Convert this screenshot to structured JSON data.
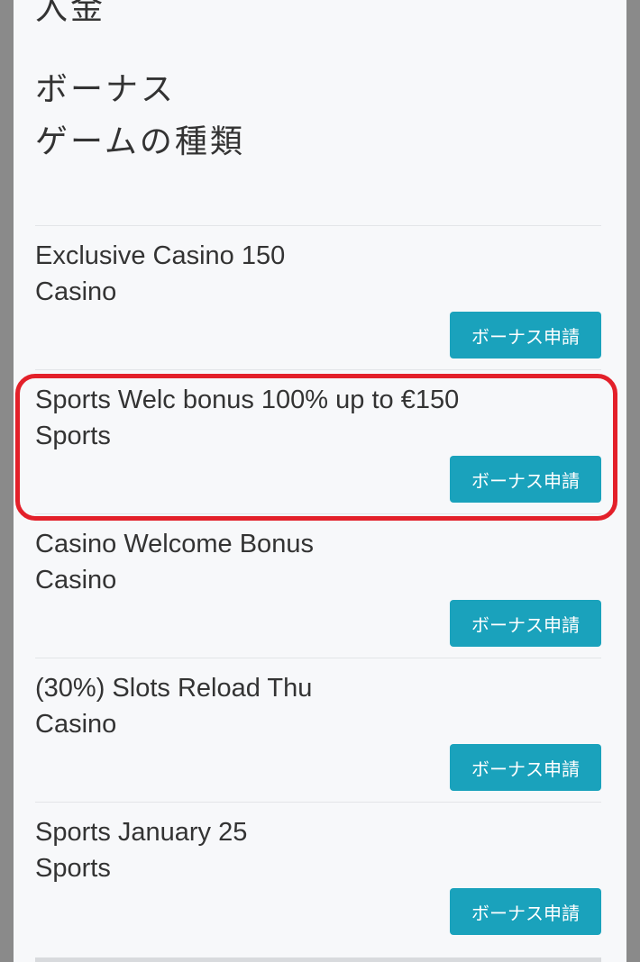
{
  "header": {
    "deposit": "入金",
    "bonus": "ボーナス",
    "game_type": "ゲームの種類"
  },
  "apply_label": "ボーナス申請",
  "bonuses": [
    {
      "name": "Exclusive Casino 150",
      "category": "Casino"
    },
    {
      "name": "Sports Welc bonus 100% up to €150",
      "category": "Sports"
    },
    {
      "name": "Casino Welcome Bonus",
      "category": "Casino"
    },
    {
      "name": "(30%) Slots Reload Thu",
      "category": "Casino"
    },
    {
      "name": "Sports January 25",
      "category": "Sports"
    }
  ],
  "colors": {
    "button": "#1aa2bc",
    "highlight": "#e3202a"
  }
}
